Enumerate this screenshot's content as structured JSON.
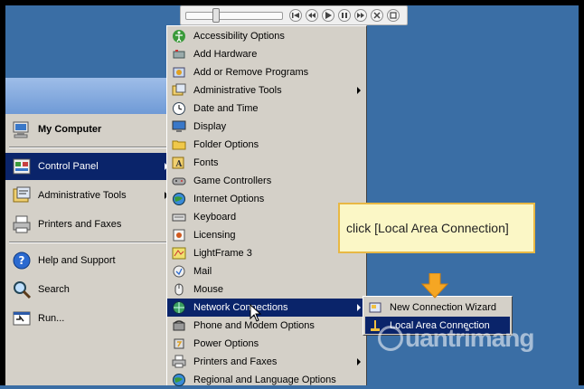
{
  "player": {
    "progress_fraction": 0.3,
    "buttons": [
      "skip-back-icon",
      "rewind-icon",
      "play-icon",
      "pause-icon",
      "fast-forward-icon",
      "close-icon",
      "fullscreen-icon"
    ]
  },
  "start_menu": {
    "pinned": [
      {
        "label": "My Computer",
        "icon": "computer-icon"
      }
    ],
    "items": [
      {
        "label": "Control Panel",
        "icon": "control-panel-icon",
        "selected": true,
        "has_submenu": true
      },
      {
        "label": "Administrative Tools",
        "icon": "admin-tools-icon",
        "has_submenu": true
      },
      {
        "label": "Printers and Faxes",
        "icon": "printer-icon"
      }
    ],
    "bottom": [
      {
        "label": "Help and Support",
        "icon": "help-icon"
      },
      {
        "label": "Search",
        "icon": "search-icon"
      },
      {
        "label": "Run...",
        "icon": "run-icon"
      }
    ]
  },
  "control_panel": {
    "items": [
      {
        "label": "Accessibility Options",
        "icon": "accessibility-icon"
      },
      {
        "label": "Add Hardware",
        "icon": "add-hardware-icon"
      },
      {
        "label": "Add or Remove Programs",
        "icon": "add-remove-programs-icon"
      },
      {
        "label": "Administrative Tools",
        "icon": "admin-tools-icon",
        "has_submenu": true
      },
      {
        "label": "Date and Time",
        "icon": "clock-icon"
      },
      {
        "label": "Display",
        "icon": "display-icon"
      },
      {
        "label": "Folder Options",
        "icon": "folder-icon"
      },
      {
        "label": "Fonts",
        "icon": "fonts-icon"
      },
      {
        "label": "Game Controllers",
        "icon": "game-controller-icon"
      },
      {
        "label": "Internet Options",
        "icon": "globe-icon"
      },
      {
        "label": "Keyboard",
        "icon": "keyboard-icon"
      },
      {
        "label": "Licensing",
        "icon": "licensing-icon"
      },
      {
        "label": "LightFrame 3",
        "icon": "lightframe-icon"
      },
      {
        "label": "Mail",
        "icon": "mail-icon"
      },
      {
        "label": "Mouse",
        "icon": "mouse-icon"
      },
      {
        "label": "Network Connections",
        "icon": "network-icon",
        "selected": true,
        "has_submenu": true
      },
      {
        "label": "Phone and Modem Options",
        "icon": "phone-icon"
      },
      {
        "label": "Power Options",
        "icon": "power-icon"
      },
      {
        "label": "Printers and Faxes",
        "icon": "printer-icon",
        "has_submenu": true
      },
      {
        "label": "Regional and Language Options",
        "icon": "globe-icon"
      }
    ]
  },
  "network_connections": {
    "items": [
      {
        "label": "New Connection Wizard",
        "icon": "wizard-icon"
      },
      {
        "label": "Local Area Connection",
        "icon": "lan-icon",
        "selected": true
      }
    ]
  },
  "callout": {
    "text": "click [Local Area Connection]"
  },
  "watermark": {
    "text": "uantrimang"
  },
  "colors": {
    "desktop": "#3a6ea5",
    "menu_bg": "#d4d0c8",
    "highlight": "#0a246a",
    "callout_bg": "#fbf7c6",
    "callout_border": "#e8b844",
    "arrow": "#f5a623"
  }
}
